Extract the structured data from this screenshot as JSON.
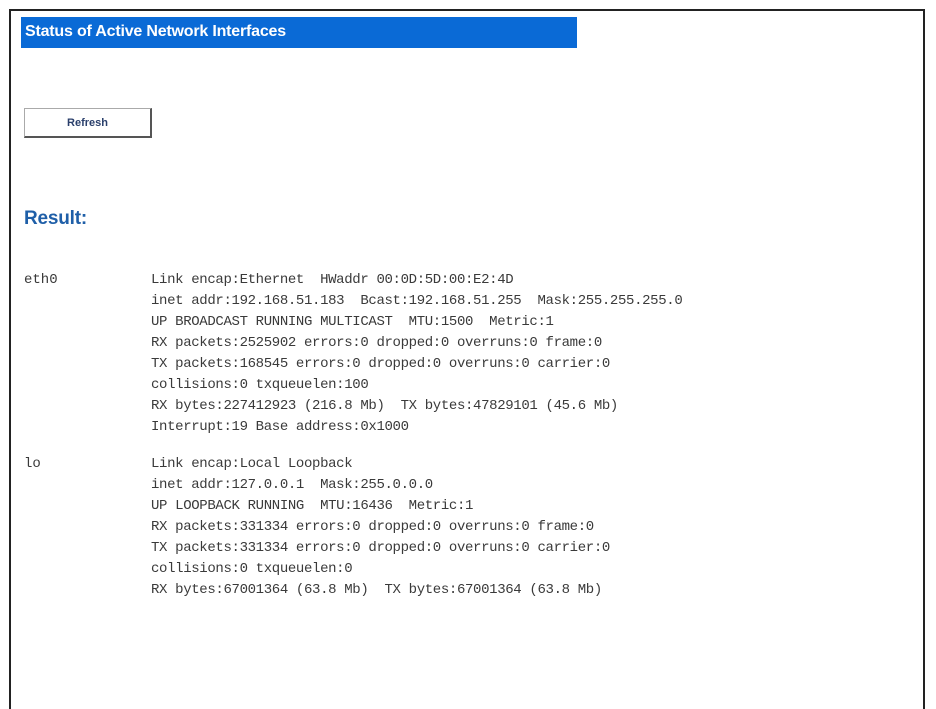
{
  "header": {
    "title": "Status of Active Network Interfaces"
  },
  "actions": {
    "refresh_label": "Refresh"
  },
  "result": {
    "heading": "Result:"
  },
  "interfaces": [
    {
      "name": "eth0",
      "lines": [
        "Link encap:Ethernet  HWaddr 00:0D:5D:00:E2:4D",
        "inet addr:192.168.51.183  Bcast:192.168.51.255  Mask:255.255.255.0",
        "UP BROADCAST RUNNING MULTICAST  MTU:1500  Metric:1",
        "RX packets:2525902 errors:0 dropped:0 overruns:0 frame:0",
        "TX packets:168545 errors:0 dropped:0 overruns:0 carrier:0",
        "collisions:0 txqueuelen:100",
        "RX bytes:227412923 (216.8 Mb)  TX bytes:47829101 (45.6 Mb)",
        "Interrupt:19 Base address:0x1000"
      ]
    },
    {
      "name": "lo",
      "lines": [
        "Link encap:Local Loopback",
        "inet addr:127.0.0.1  Mask:255.0.0.0",
        "UP LOOPBACK RUNNING  MTU:16436  Metric:1",
        "RX packets:331334 errors:0 dropped:0 overruns:0 frame:0",
        "TX packets:331334 errors:0 dropped:0 overruns:0 carrier:0",
        "collisions:0 txqueuelen:0",
        "RX bytes:67001364 (63.8 Mb)  TX bytes:67001364 (63.8 Mb)"
      ]
    }
  ],
  "colors": {
    "title_bar_bg": "#0a6ad6",
    "title_text": "#ffffff",
    "result_heading": "#1f5fa8",
    "body_text": "#3a3a3a"
  }
}
